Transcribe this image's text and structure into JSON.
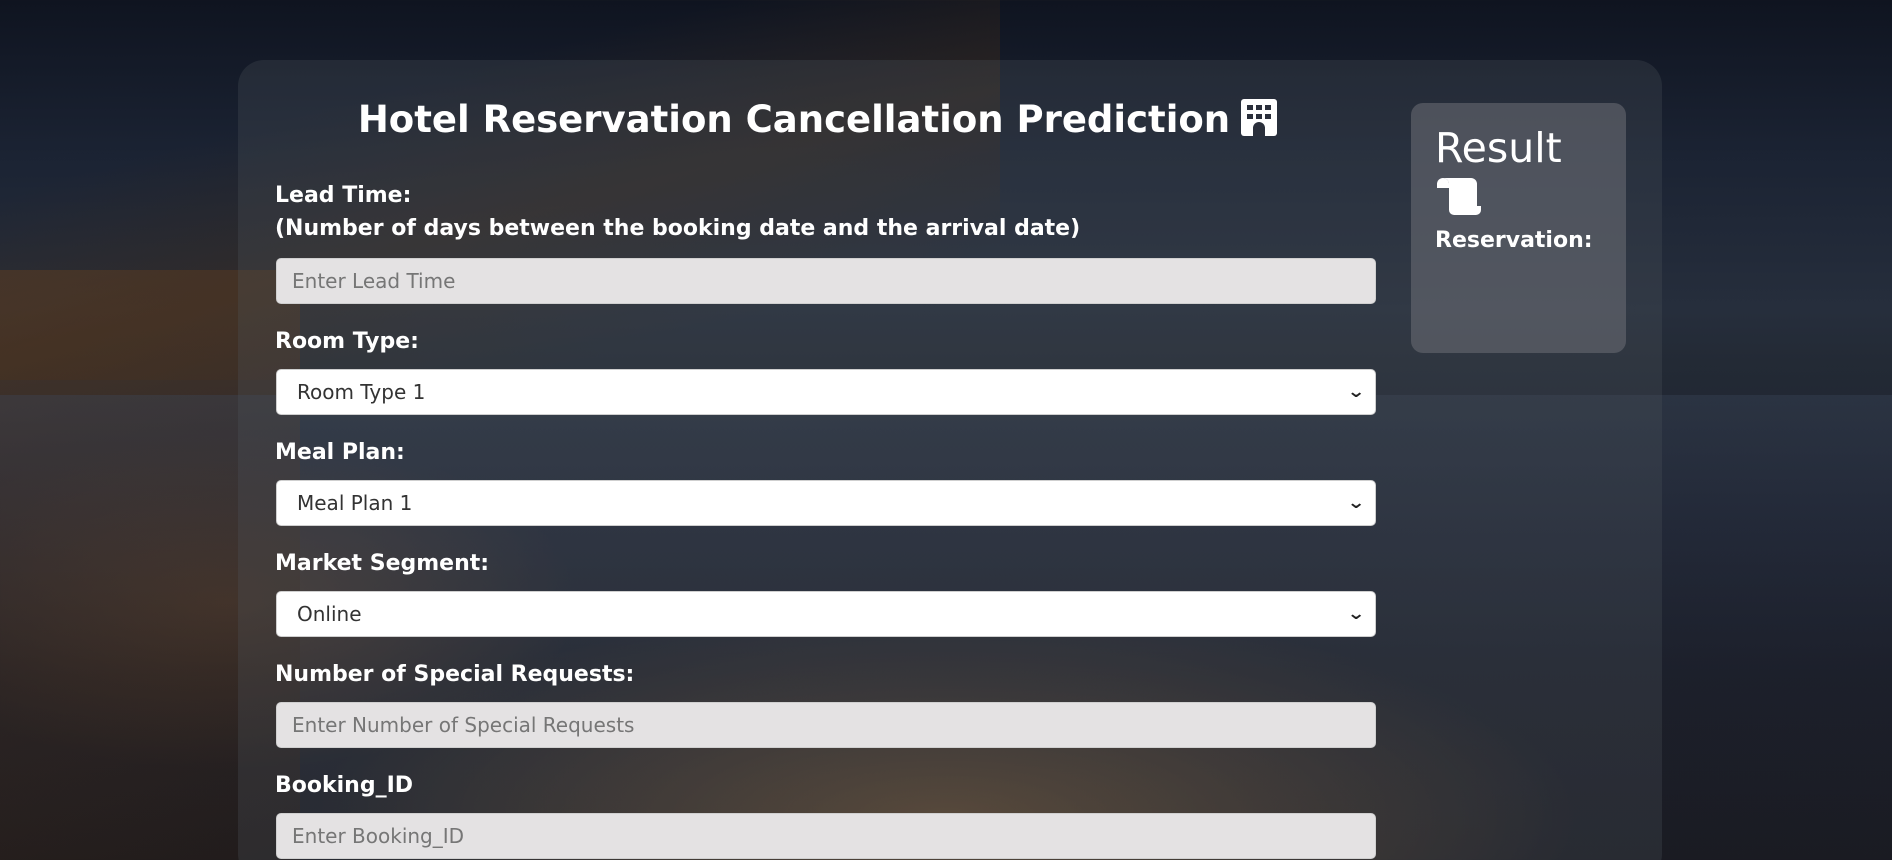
{
  "page": {
    "title": "Hotel Reservation Cancellation Prediction",
    "title_icon": "hotel-building-icon"
  },
  "form": {
    "lead_time": {
      "label_line1": "Lead Time:",
      "label_line2": "(Number of days between the booking date and the arrival date)",
      "placeholder": "Enter Lead Time",
      "value": ""
    },
    "room_type": {
      "label": "Room Type:",
      "selected": "Room Type 1"
    },
    "meal_plan": {
      "label": "Meal Plan:",
      "selected": "Meal Plan 1"
    },
    "market_segment": {
      "label": "Market Segment:",
      "selected": "Online"
    },
    "special_requests": {
      "label": "Number of Special Requests:",
      "placeholder": "Enter Number of Special Requests",
      "value": ""
    },
    "booking_id": {
      "label": "Booking_ID",
      "placeholder": "Enter Booking_ID",
      "value": ""
    }
  },
  "result": {
    "title": "Result",
    "icon": "scroll-icon",
    "reservation_label": "Reservation:"
  },
  "colors": {
    "text": "#ffffff",
    "input_bg": "#e4e2e3",
    "select_bg": "#ffffff"
  }
}
